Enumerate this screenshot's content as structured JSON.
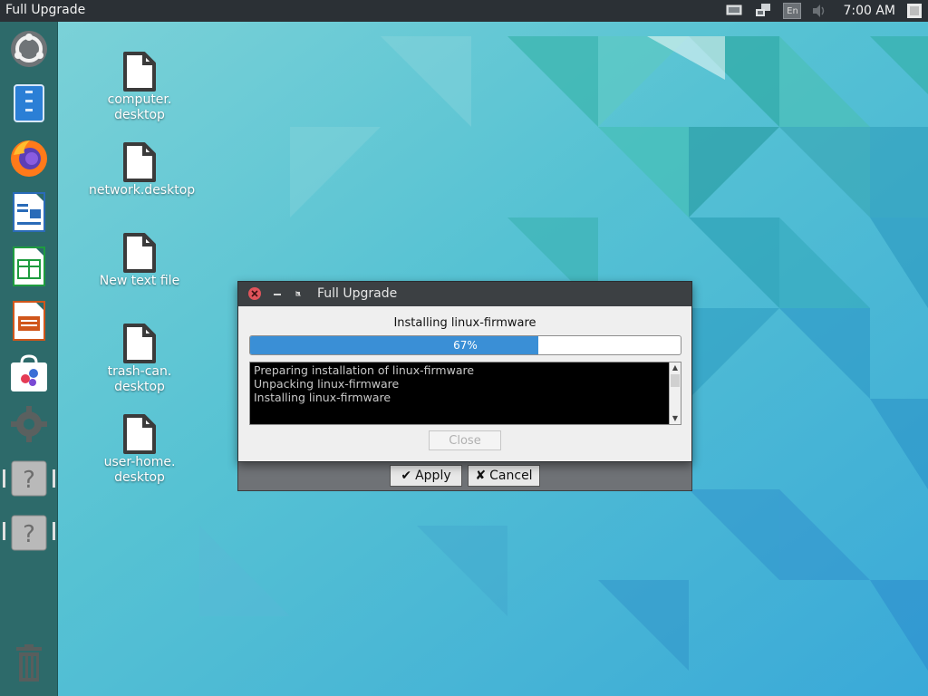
{
  "top_panel": {
    "title": "Full Upgrade",
    "language": "En",
    "clock": "7:00 AM",
    "icons": [
      "display-icon",
      "network-icon",
      "language-icon",
      "volume-icon"
    ]
  },
  "dock": {
    "items": [
      {
        "name": "ubuntu-logo-icon"
      },
      {
        "name": "files-icon"
      },
      {
        "name": "firefox-icon"
      },
      {
        "name": "writer-icon"
      },
      {
        "name": "calc-icon"
      },
      {
        "name": "impress-icon"
      },
      {
        "name": "software-store-icon"
      },
      {
        "name": "settings-gear-icon"
      },
      {
        "name": "unknown-app-icon"
      },
      {
        "name": "unknown-app-icon"
      },
      {
        "name": "trash-icon"
      }
    ]
  },
  "desktop": {
    "icons": [
      {
        "label": "computer.\ndesktop"
      },
      {
        "label": "network.desktop"
      },
      {
        "label": "New text file"
      },
      {
        "label": "trash-can.\ndesktop"
      },
      {
        "label": "user-home.\ndesktop"
      }
    ]
  },
  "background_window": {
    "apply_label": "Apply",
    "cancel_label": "Cancel"
  },
  "dialog": {
    "title": "Full Upgrade",
    "status": "Installing linux-firmware",
    "progress_percent": 67,
    "progress_text": "67%",
    "log_lines": [
      "Preparing installation of linux-firmware",
      "Unpacking linux-firmware",
      "Installing linux-firmware"
    ],
    "close_label": "Close"
  },
  "colors": {
    "panel": "#2b3035",
    "dock": "#2d6a6a",
    "progress_fill": "#3a8fd6",
    "close_button": "#e0545b"
  }
}
